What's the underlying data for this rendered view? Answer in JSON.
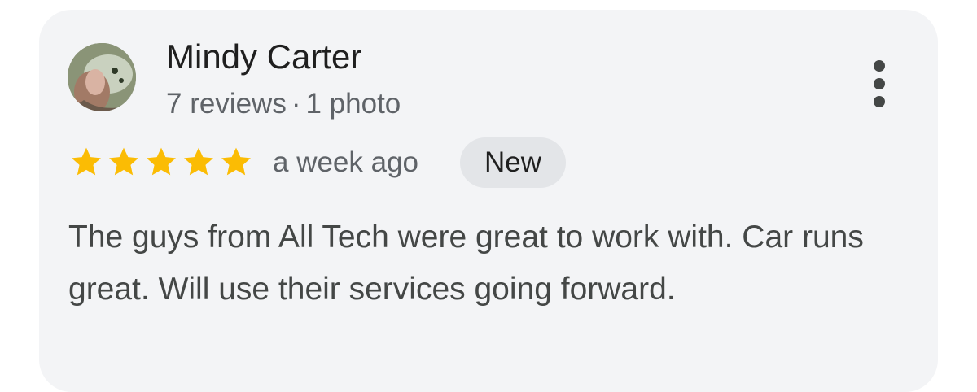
{
  "review": {
    "author": "Mindy Carter",
    "reviews_count": "7 reviews",
    "separator": "·",
    "photos_count": "1 photo",
    "rating": 5,
    "max_rating": 5,
    "time": "a week ago",
    "badge": "New",
    "text": "The guys from All Tech were great to work with. Car runs great. Will use their services going forward."
  },
  "colors": {
    "star": "#fbbc04",
    "card_background": "#f3f4f6",
    "badge_background": "#e3e5e8"
  },
  "icons": {
    "menu": "more-vert-icon",
    "rating": "star-icon"
  }
}
